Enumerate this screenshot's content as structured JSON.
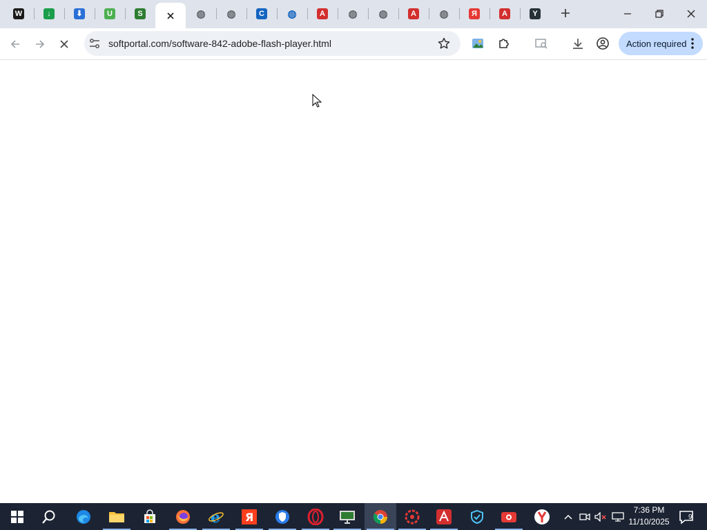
{
  "browser": {
    "tabs": [
      {
        "icon": "w-logo-icon",
        "glyph": "W",
        "color": "#1a1a1a"
      },
      {
        "icon": "green-download-icon",
        "glyph": "↓",
        "color": "#1a9e4b"
      },
      {
        "icon": "blue-download-icon",
        "glyph": "⬇",
        "color": "#2a6fd6"
      },
      {
        "icon": "green-u-icon",
        "glyph": "U",
        "color": "#4caf50"
      },
      {
        "icon": "s-logo-icon",
        "glyph": "S",
        "color": "#2e7d32"
      },
      {
        "icon": "loading-tab-icon",
        "glyph": "",
        "color": "#ffffff",
        "active": true
      },
      {
        "icon": "globe-tab-icon",
        "glyph": "◍",
        "color": "#5f6368"
      },
      {
        "icon": "globe-tab-icon",
        "glyph": "◍",
        "color": "#5f6368"
      },
      {
        "icon": "c-logo-icon",
        "glyph": "C",
        "color": "#1565c0"
      },
      {
        "icon": "globe-tab-icon",
        "glyph": "◍",
        "color": "#1565c0"
      },
      {
        "icon": "red-logo-icon",
        "glyph": "A",
        "color": "#d32f2f"
      },
      {
        "icon": "globe-tab-icon",
        "glyph": "◍",
        "color": "#5f6368"
      },
      {
        "icon": "globe-tab-icon",
        "glyph": "◍",
        "color": "#5f6368"
      },
      {
        "icon": "red-logo-icon",
        "glyph": "A",
        "color": "#d32f2f"
      },
      {
        "icon": "globe-tab-icon",
        "glyph": "◍",
        "color": "#5f6368"
      },
      {
        "icon": "yandex-icon",
        "glyph": "Я",
        "color": "#e53935"
      },
      {
        "icon": "red-logo-icon",
        "glyph": "A",
        "color": "#d32f2f"
      },
      {
        "icon": "y-logo-icon",
        "glyph": "Y",
        "color": "#263238"
      }
    ],
    "address": {
      "url": "softportal.com/software-842-adobe-flash-player.html"
    },
    "action_required_label": "Action required"
  },
  "taskbar": {
    "clock_time": "7:36 PM",
    "clock_date": "11/10/2025",
    "notification_count": "9",
    "accent": "#8ab4e8"
  }
}
